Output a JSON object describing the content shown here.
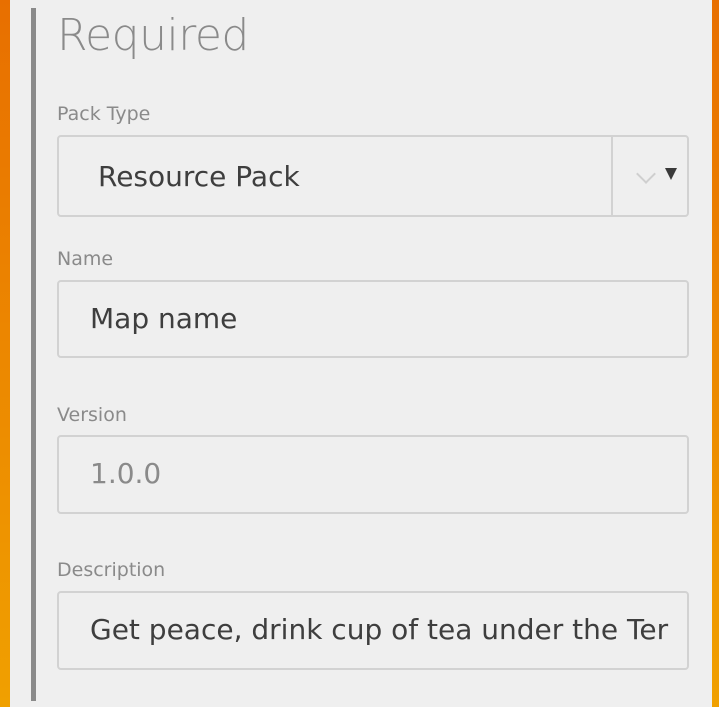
{
  "section": {
    "title": "Required"
  },
  "fields": {
    "pack_type": {
      "label": "Pack Type",
      "value": "Resource Pack"
    },
    "name": {
      "label": "Name",
      "value": "Map name"
    },
    "version": {
      "label": "Version",
      "placeholder": "1.0.0"
    },
    "description": {
      "label": "Description",
      "value": "Get peace, drink cup of tea under the Ter"
    }
  },
  "colors": {
    "accent": "#e86f00",
    "panel": "#efefef"
  }
}
